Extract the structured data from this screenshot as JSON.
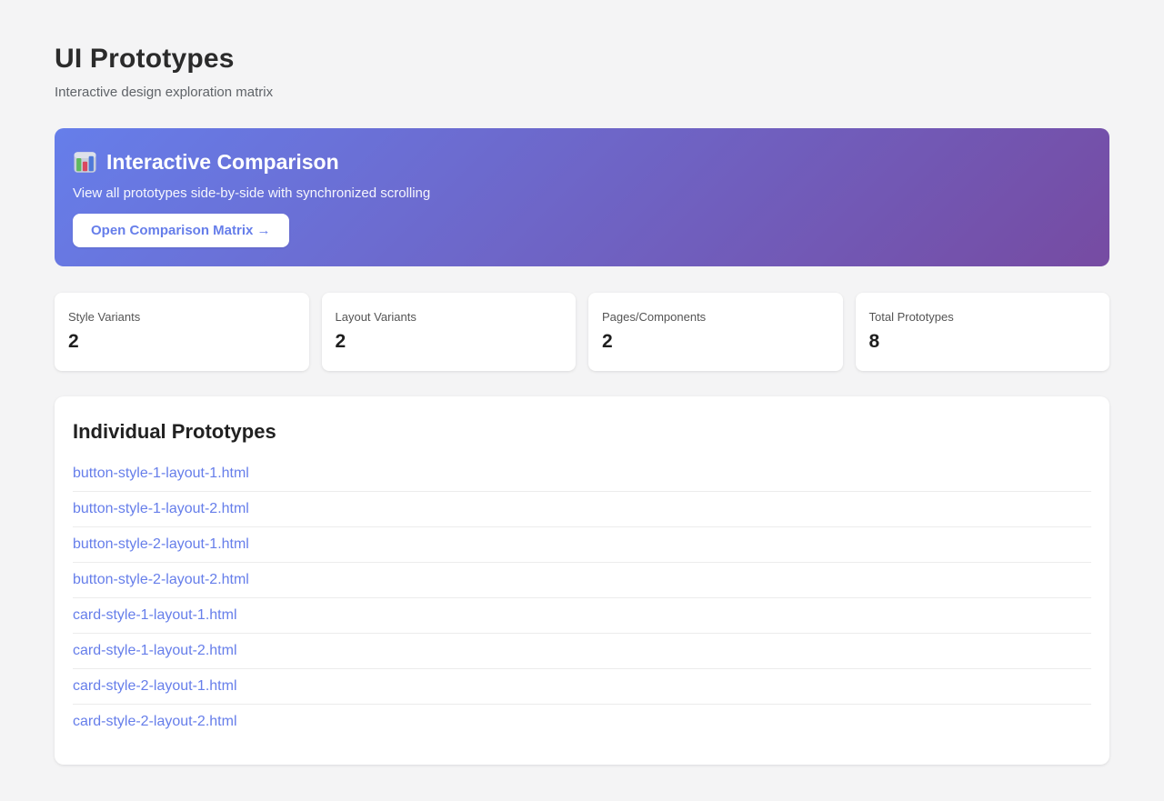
{
  "page": {
    "title": "UI Prototypes",
    "subtitle": "Interactive design exploration matrix"
  },
  "banner": {
    "icon": "bar-chart-emoji",
    "title": "Interactive Comparison",
    "description": "View all prototypes side-by-side with synchronized scrolling",
    "button_label": "Open Comparison Matrix →",
    "gradient_start": "#667eea",
    "gradient_end": "#764ba2"
  },
  "stats": [
    {
      "label": "Style Variants",
      "value": "2"
    },
    {
      "label": "Layout Variants",
      "value": "2"
    },
    {
      "label": "Pages/Components",
      "value": "2"
    },
    {
      "label": "Total Prototypes",
      "value": "8"
    }
  ],
  "prototypes": {
    "heading": "Individual Prototypes",
    "links": [
      "button-style-1-layout-1.html",
      "button-style-1-layout-2.html",
      "button-style-2-layout-1.html",
      "button-style-2-layout-2.html",
      "card-style-1-layout-1.html",
      "card-style-1-layout-2.html",
      "card-style-2-layout-1.html",
      "card-style-2-layout-2.html"
    ]
  },
  "colors": {
    "accent": "#667eea",
    "link": "#667eea",
    "page_background": "#f4f4f5"
  }
}
